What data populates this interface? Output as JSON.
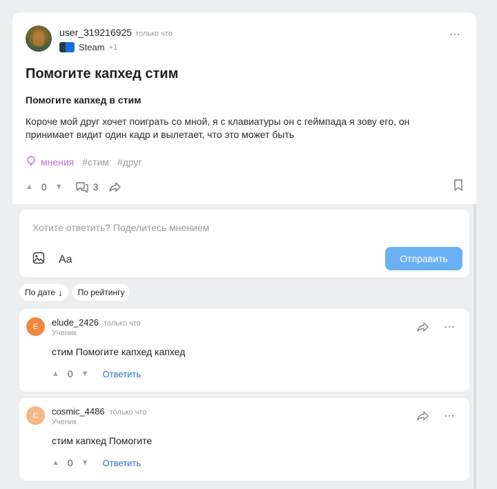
{
  "post": {
    "author": {
      "username": "user_319216925",
      "timestamp": "только что",
      "community": "Steam",
      "community_more": "+1"
    },
    "title": "Помогите капхед стим",
    "subtitle": "Помогите капхед в стим",
    "body": "Короче мой друг хочет поиграть со мной, я с клавиатуры он с геймпада я зову его, он принимает видит один кадр и вылетает, что это может быть",
    "topic_tag": "мнения",
    "tags": [
      "#стим",
      "#друг"
    ],
    "votes": "0",
    "comments_count": "3",
    "more_icon": "⋯"
  },
  "reply": {
    "placeholder": "Хотите ответить? Поделитесь мнением",
    "text_format_label": "Aa",
    "send_label": "Отправить",
    "send_color": "#6ab0f5"
  },
  "sort": {
    "by_date": "По дате",
    "by_date_arrow": "↓",
    "by_rating": "По рейтингу"
  },
  "comments": [
    {
      "initial": "E",
      "avatar_color": "#f0883e",
      "username": "elude_2426",
      "timestamp": "только что",
      "role": "Ученик",
      "text": "стим Помогите капхед капхед",
      "votes": "0",
      "reply_label": "Ответить"
    },
    {
      "initial": "C",
      "avatar_color": "#f5b888",
      "username": "cosmic_4486",
      "timestamp": "только что",
      "role": "Ученик",
      "text": "стим капхед Помогите",
      "votes": "0",
      "reply_label": "Ответить"
    }
  ],
  "accent_color": "#2a6fc9",
  "topic_color": "#c070d8"
}
